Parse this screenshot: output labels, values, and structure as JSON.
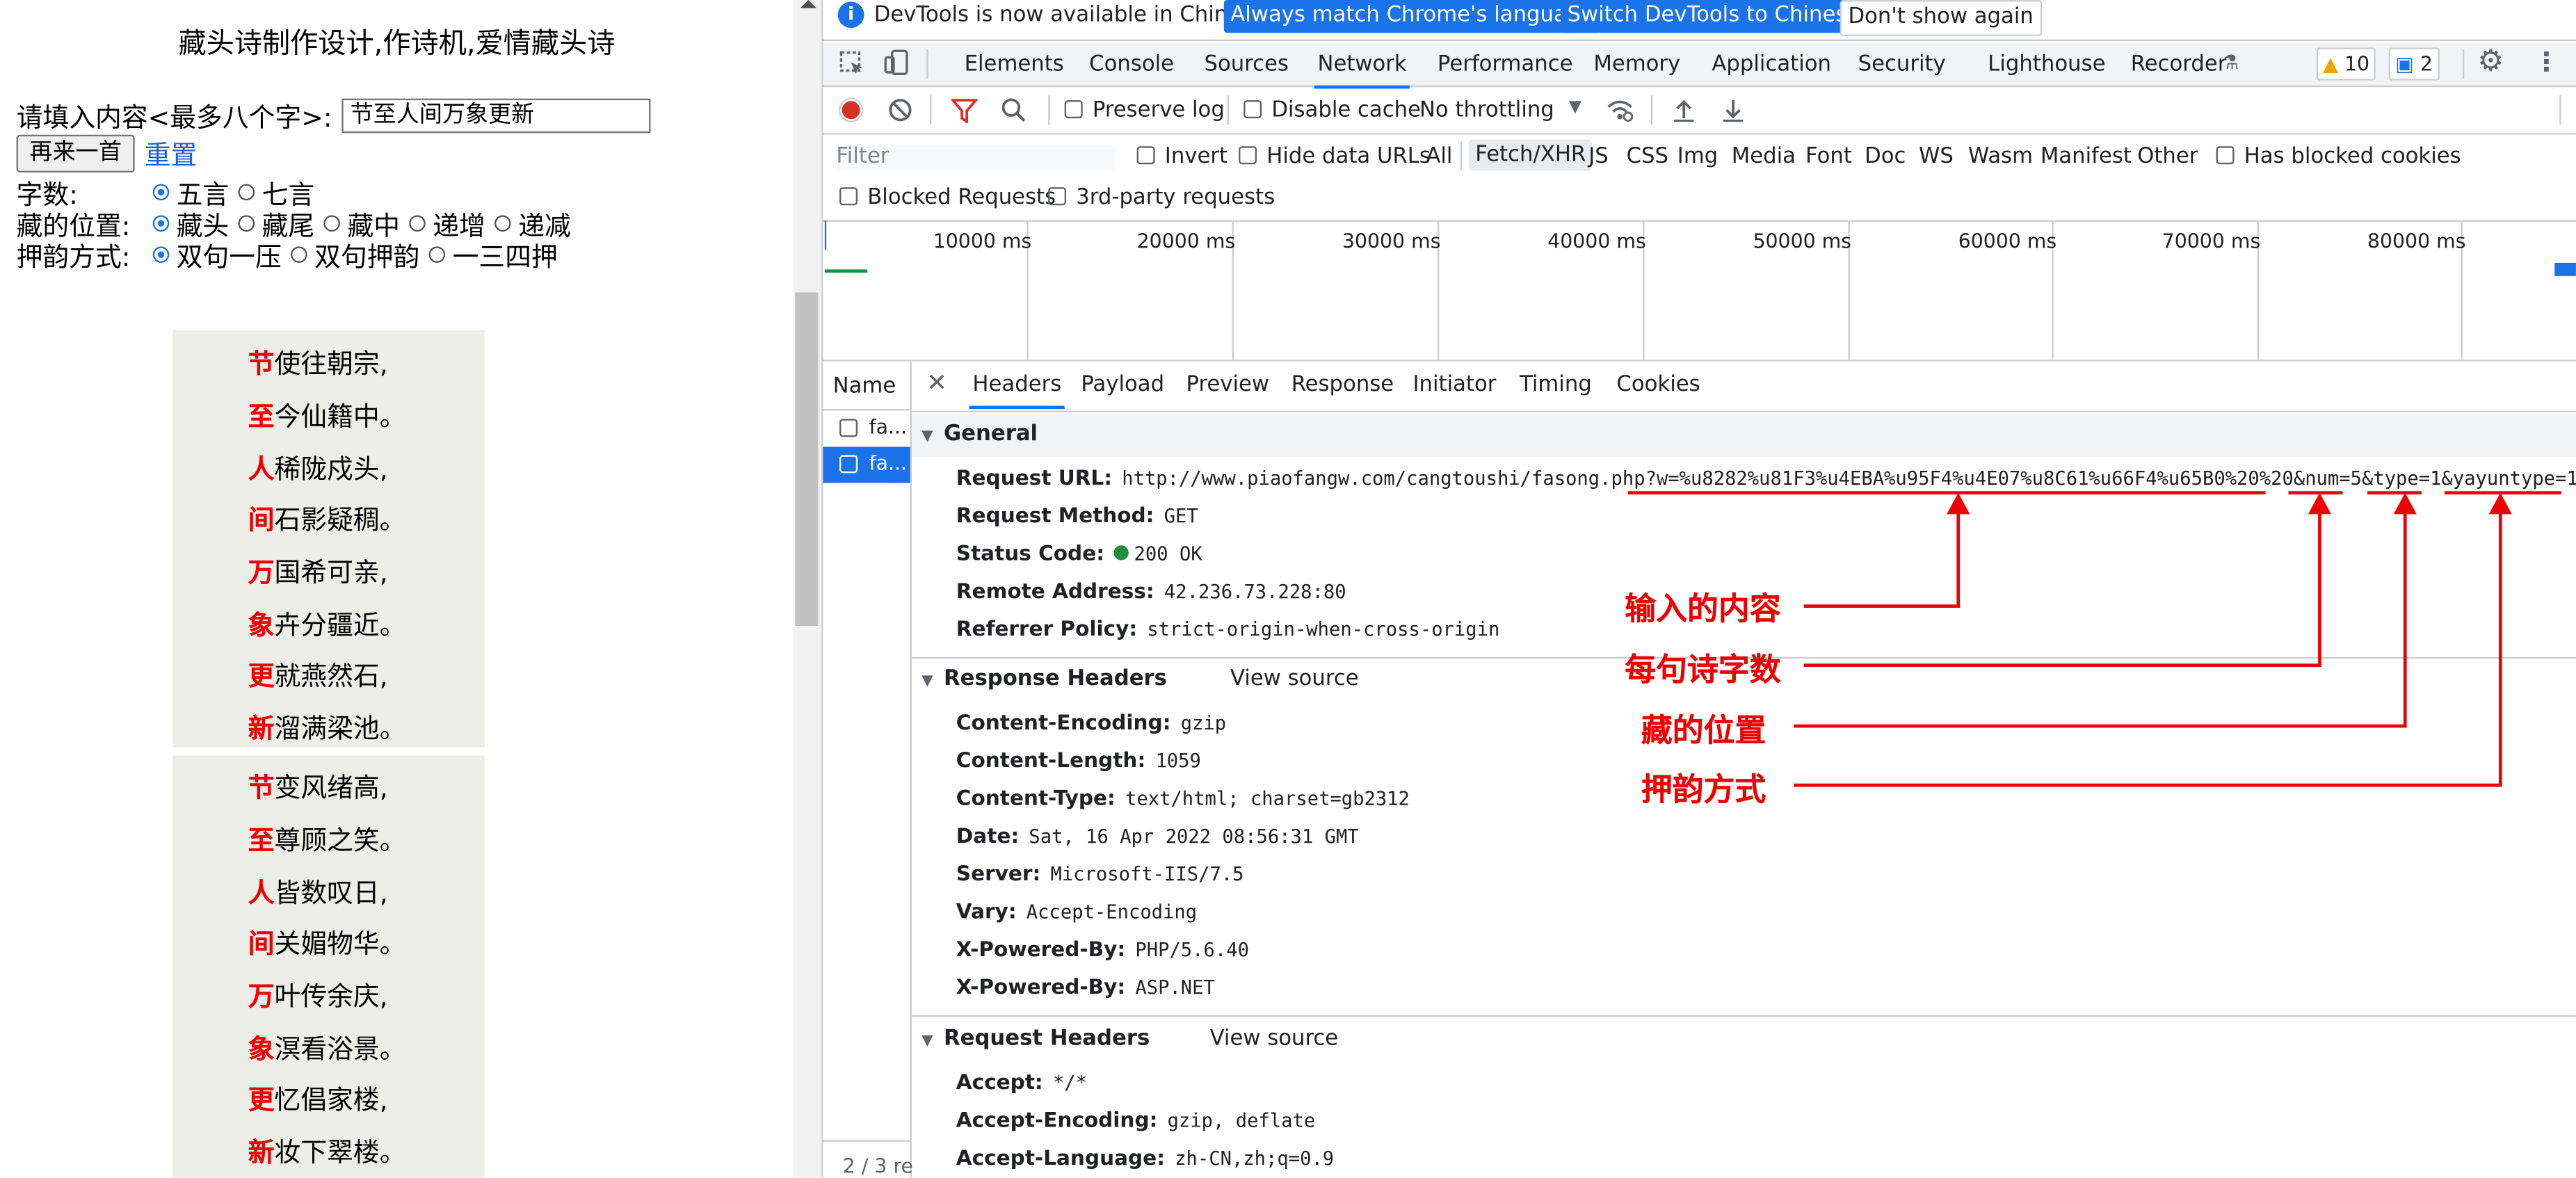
{
  "left_page": {
    "title": "藏头诗制作设计,作诗机,爱情藏头诗",
    "input_label": "请填入内容<最多八个字>:",
    "input_value": "节至人间万象更新",
    "again_button": "再来一首",
    "reset_link": "重置",
    "word_count_label": "字数:",
    "word_count_options": [
      "五言",
      "七言"
    ],
    "position_label": "藏的位置:",
    "position_options": [
      "藏头",
      "藏尾",
      "藏中",
      "递增",
      "递减"
    ],
    "rhyme_label": "押韵方式:",
    "rhyme_options": [
      "双句一压",
      "双句押韵",
      "一三四押"
    ],
    "poems": [
      [
        {
          "head": "节",
          "rest": "使往朝宗,"
        },
        {
          "head": "至",
          "rest": "今仙籍中。"
        },
        {
          "head": "人",
          "rest": "稀陇戍头,"
        },
        {
          "head": "间",
          "rest": "石影疑稠。"
        },
        {
          "head": "万",
          "rest": "国希可亲,"
        },
        {
          "head": "象",
          "rest": "卉分疆近。"
        },
        {
          "head": "更",
          "rest": "就燕然石,"
        },
        {
          "head": "新",
          "rest": "溜满梁池。"
        }
      ],
      [
        {
          "head": "节",
          "rest": "变风绪高,"
        },
        {
          "head": "至",
          "rest": "尊顾之笑。"
        },
        {
          "head": "人",
          "rest": "皆数叹日,"
        },
        {
          "head": "间",
          "rest": "关媚物华。"
        },
        {
          "head": "万",
          "rest": "叶传余庆,"
        },
        {
          "head": "象",
          "rest": "溟看浴景。"
        },
        {
          "head": "更",
          "rest": "忆倡家楼,"
        },
        {
          "head": "新",
          "rest": "妆下翠楼。"
        }
      ]
    ]
  },
  "devtools": {
    "info_text": "DevTools is now available in Chinese!",
    "info_btn1": "Always match Chrome's language",
    "info_btn2": "Switch DevTools to Chinese",
    "info_btn3": "Don't show again",
    "tabs": [
      "Elements",
      "Console",
      "Sources",
      "Network",
      "Performance",
      "Memory",
      "Application",
      "Security",
      "Lighthouse",
      "Recorder"
    ],
    "active_tab": "Network",
    "warn_count": "10",
    "msg_count": "2",
    "toolbar": {
      "preserve_log": "Preserve log",
      "disable_cache": "Disable cache",
      "throttling": "No throttling"
    },
    "filter": {
      "placeholder": "Filter",
      "invert": "Invert",
      "hide_data_urls": "Hide data URLs",
      "types": [
        "All",
        "Fetch/XHR",
        "JS",
        "CSS",
        "Img",
        "Media",
        "Font",
        "Doc",
        "WS",
        "Wasm",
        "Manifest",
        "Other"
      ],
      "active_type": "Fetch/XHR",
      "blocked_cookies": "Has blocked cookies",
      "blocked_requests": "Blocked Requests",
      "third_party": "3rd-party requests"
    },
    "timeline_ticks": [
      "10000 ms",
      "20000 ms",
      "30000 ms",
      "40000 ms",
      "50000 ms",
      "60000 ms",
      "70000 ms",
      "80000 ms"
    ],
    "name_header": "Name",
    "requests": [
      "fa...",
      "fa..."
    ],
    "request_count": "2 / 3 re",
    "detail_tabs": [
      "Headers",
      "Payload",
      "Preview",
      "Response",
      "Initiator",
      "Timing",
      "Cookies"
    ],
    "active_detail_tab": "Headers",
    "general": {
      "title": "General",
      "request_url_key": "Request URL:",
      "request_url_base": "http://www.piaofangw.com/cangtoushi/fasong.php",
      "request_url_w": "?w=%u8282%u81F3%u4EBA%u95F4%u4E07%u8C61%u66F4%u65B0%20%20",
      "request_url_num": "&num=5",
      "request_url_type": "&type=1",
      "request_url_yayun": "&yayuntype=1",
      "method_key": "Request Method:",
      "method": "GET",
      "status_key": "Status Code:",
      "status": "200 OK",
      "remote_key": "Remote Address:",
      "remote": "42.236.73.228:80",
      "referrer_key": "Referrer Policy:",
      "referrer": "strict-origin-when-cross-origin"
    },
    "response_headers_title": "Response Headers",
    "view_source": "View source",
    "response_headers": [
      {
        "k": "Content-Encoding:",
        "v": "gzip"
      },
      {
        "k": "Content-Length:",
        "v": "1059"
      },
      {
        "k": "Content-Type:",
        "v": "text/html; charset=gb2312"
      },
      {
        "k": "Date:",
        "v": "Sat, 16 Apr 2022 08:56:31 GMT"
      },
      {
        "k": "Server:",
        "v": "Microsoft-IIS/7.5"
      },
      {
        "k": "Vary:",
        "v": "Accept-Encoding"
      },
      {
        "k": "X-Powered-By:",
        "v": "PHP/5.6.40"
      },
      {
        "k": "X-Powered-By:",
        "v": "ASP.NET"
      }
    ],
    "request_headers_title": "Request Headers",
    "request_headers": [
      {
        "k": "Accept:",
        "v": "*/*"
      },
      {
        "k": "Accept-Encoding:",
        "v": "gzip, deflate"
      },
      {
        "k": "Accept-Language:",
        "v": "zh-CN,zh;q=0.9"
      }
    ]
  },
  "annotations": [
    "输入的内容",
    "每句诗字数",
    "藏的位置",
    "押韵方式"
  ],
  "colors": {
    "accent": "#1a73e8",
    "annotation": "#e00000",
    "poem_head": "#e00000",
    "poem_bg": "#eeeee9"
  }
}
